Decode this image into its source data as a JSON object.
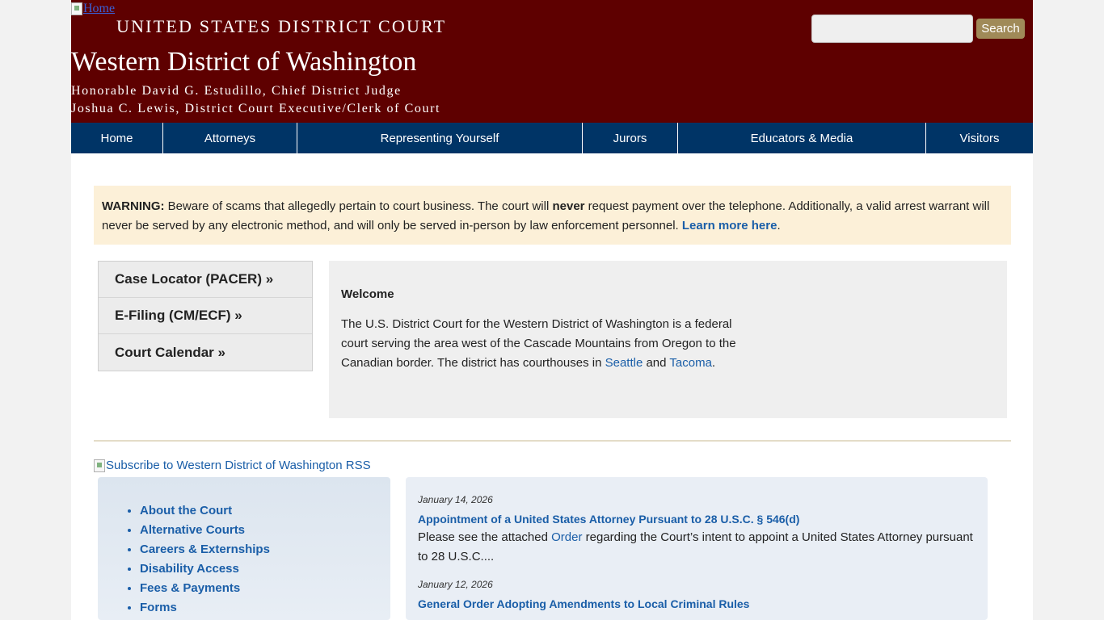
{
  "header": {
    "home_alt": "Home",
    "court_name": "UNITED STATES DISTRICT COURT",
    "district_name": "Western District of Washington",
    "chief_judge": "Honorable David G. Estudillo, Chief District Judge",
    "clerk": "Joshua C. Lewis, District Court Executive/Clerk of Court"
  },
  "search": {
    "placeholder": "",
    "button_label": "Search"
  },
  "nav": {
    "items": [
      {
        "label": "Home"
      },
      {
        "label": "Attorneys"
      },
      {
        "label": "Representing Yourself"
      },
      {
        "label": "Jurors"
      },
      {
        "label": "Educators & Media"
      },
      {
        "label": "Visitors"
      }
    ]
  },
  "warning": {
    "label": "WARNING:",
    "text_part1": " Beware of scams that allegedly pertain to court business. The court will ",
    "emphasis": "never",
    "text_part2": " request payment over the telephone. Additionally, a valid arrest warrant will never be served by any electronic method, and will only be served in-person by law enforcement personnel. ",
    "link_label": "Learn more here",
    "trailing": "."
  },
  "quick_links": [
    {
      "label": "Case Locator (PACER) »"
    },
    {
      "label": "E-Filing (CM/ECF) »"
    },
    {
      "label": "Court Calendar »"
    }
  ],
  "welcome": {
    "title": "Welcome",
    "text_part1": "The U.S. District Court for the Western District of Washington is a federal court serving the area west of the Cascade Mountains from Oregon to the Canadian border. The district has courthouses in ",
    "link_seattle": "Seattle",
    "text_and": " and ",
    "link_tacoma": "Tacoma",
    "trailing": "."
  },
  "rss": {
    "alt_text": "Subscribe to Western District of Washington RSS"
  },
  "sidebar_links": [
    {
      "label": "About the Court"
    },
    {
      "label": "Alternative Courts"
    },
    {
      "label": "Careers & Externships"
    },
    {
      "label": "Disability Access"
    },
    {
      "label": "Fees & Payments"
    },
    {
      "label": "Forms"
    }
  ],
  "news": [
    {
      "date": "January 14, 2026",
      "title": "Appointment of a United States Attorney Pursuant to 28 U.S.C. § 546(d)",
      "body_part1": "Please see the attached ",
      "body_link": "Order",
      "body_part2": " regarding the Court’s intent to appoint a United States Attorney pursuant to 28 U.S.C...."
    },
    {
      "date": "January 12, 2026",
      "title": "General Order Adopting Amendments to Local Criminal Rules"
    }
  ]
}
